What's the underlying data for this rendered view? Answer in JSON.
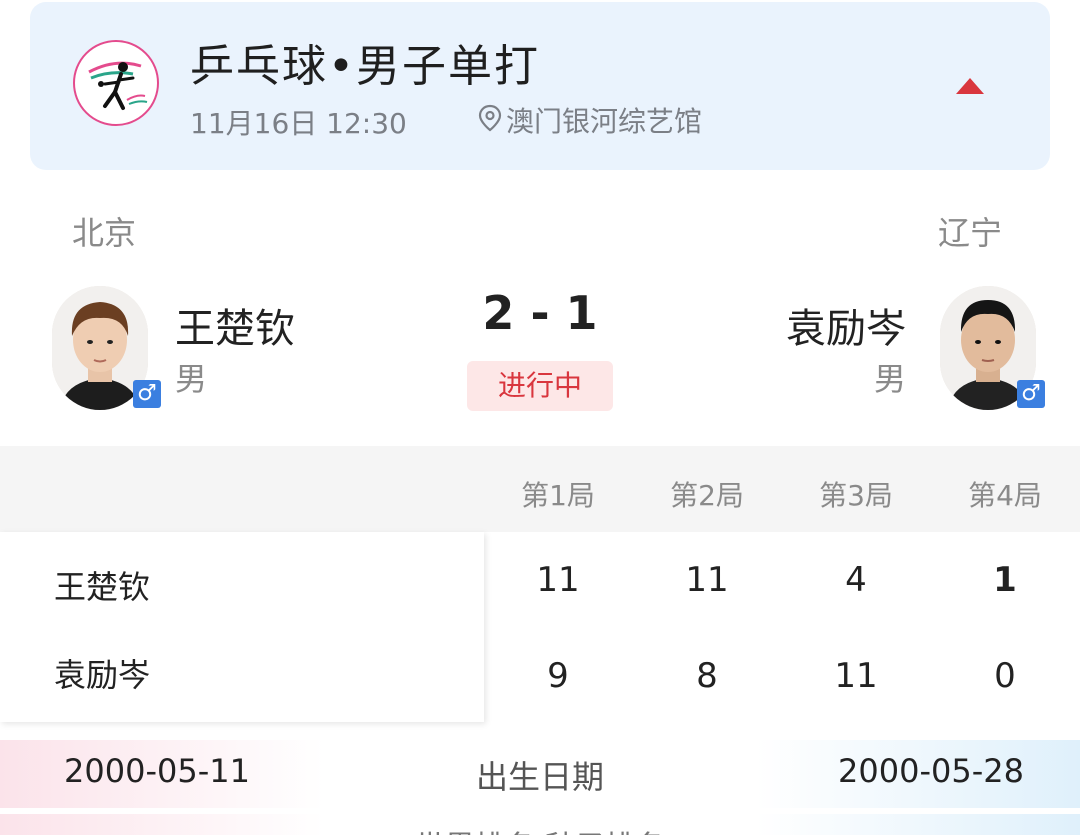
{
  "event": {
    "title": "乒乓球•男子单打",
    "datetime": "11月16日 12:30",
    "venue": "澳门银河综艺馆",
    "logo_icon": "table-tennis-icon",
    "collapse_icon": "triangle-up-icon",
    "accent_color": "#d9363e",
    "card_color": "#eaf3fd"
  },
  "match": {
    "score": "2 - 1",
    "status": "进行中"
  },
  "players": {
    "left": {
      "region": "北京",
      "name": "王楚钦",
      "gender": "男",
      "gender_icon": "male-icon",
      "birth": "2000-05-11"
    },
    "right": {
      "region": "辽宁",
      "name": "袁励岑",
      "gender": "男",
      "gender_icon": "male-icon",
      "birth": "2000-05-28"
    }
  },
  "games": {
    "headers": [
      "第1局",
      "第2局",
      "第3局",
      "第4局"
    ],
    "left_scores": [
      "11",
      "11",
      "4",
      "1"
    ],
    "right_scores": [
      "9",
      "8",
      "11",
      "0"
    ]
  },
  "info": {
    "birth_label": "出生日期",
    "rank_label": "世界排名/种子排名"
  }
}
